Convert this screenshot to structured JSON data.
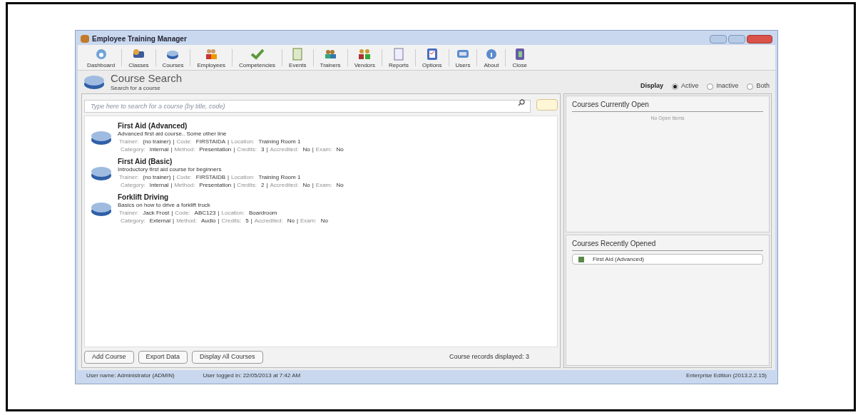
{
  "window": {
    "title": "Employee Training Manager"
  },
  "toolbar": [
    {
      "label": "Dashboard"
    },
    {
      "label": "Classes"
    },
    {
      "label": "Courses"
    },
    {
      "label": "Employees"
    },
    {
      "label": "Competencies"
    },
    {
      "label": "Events"
    },
    {
      "label": "Trainers"
    },
    {
      "label": "Vendors"
    },
    {
      "label": "Reports"
    },
    {
      "label": "Options"
    },
    {
      "label": "Users"
    },
    {
      "label": "About"
    },
    {
      "label": "Close"
    }
  ],
  "header": {
    "title": "Course Search",
    "subtitle": "Search for a course"
  },
  "display": {
    "label": "Display",
    "options": [
      {
        "label": "Active",
        "selected": true
      },
      {
        "label": "Inactive",
        "selected": false
      },
      {
        "label": "Both",
        "selected": false
      }
    ]
  },
  "search": {
    "placeholder": "Type here to search for a course (by title, code)"
  },
  "courses": [
    {
      "title": "First Aid (Advanced)",
      "description": "Advanced first aid course.. Some other line",
      "lines": [
        [
          {
            "label": "Trainer:",
            "value": "(no trainer)"
          },
          {
            "label": "Code:",
            "value": "FIRSTAIDA"
          },
          {
            "label": "Location:",
            "value": "Training Room 1"
          }
        ],
        [
          {
            "label": "Category:",
            "value": "Internal"
          },
          {
            "label": "Method:",
            "value": "Presentation"
          },
          {
            "label": "Credits:",
            "value": "3"
          },
          {
            "label": "Accredited:",
            "value": "No"
          },
          {
            "label": "Exam:",
            "value": "No"
          }
        ]
      ]
    },
    {
      "title": "First Aid (Basic)",
      "description": "Introductory first aid course for beginners",
      "lines": [
        [
          {
            "label": "Trainer:",
            "value": "(no trainer)"
          },
          {
            "label": "Code:",
            "value": "FIRSTAIDB"
          },
          {
            "label": "Location:",
            "value": "Training Room 1"
          }
        ],
        [
          {
            "label": "Category:",
            "value": "Internal"
          },
          {
            "label": "Method:",
            "value": "Presentation"
          },
          {
            "label": "Credits:",
            "value": "2"
          },
          {
            "label": "Accredited:",
            "value": "No"
          },
          {
            "label": "Exam:",
            "value": "No"
          }
        ]
      ]
    },
    {
      "title": "Forklift Driving",
      "description": "Basics on how to drive a forklift truck",
      "lines": [
        [
          {
            "label": "Trainer:",
            "value": "Jack Frost"
          },
          {
            "label": "Code:",
            "value": "ABC123"
          },
          {
            "label": "Location:",
            "value": "Boardroom"
          }
        ],
        [
          {
            "label": "Category:",
            "value": "External"
          },
          {
            "label": "Method:",
            "value": "Audio"
          },
          {
            "label": "Credits:",
            "value": "5"
          },
          {
            "label": "Accredited:",
            "value": "No"
          },
          {
            "label": "Exam:",
            "value": "No"
          }
        ]
      ]
    }
  ],
  "field_separator": "|",
  "buttons": [
    "Add Course",
    "Export Data",
    "Display All Courses"
  ],
  "record_count": "Course records displayed: 3",
  "open_panel": {
    "title": "Courses Currently Open",
    "empty_text": "No Open Items"
  },
  "recent_panel": {
    "title": "Courses Recently Opened",
    "items": [
      "First Aid (Advanced)"
    ]
  },
  "status_bar": {
    "user": "User name: Administrator (ADMIN)",
    "logged_in": "User logged in: 22/05/2013 at 7:42 AM",
    "edition": "Enterprise Edition (2013.2.2.15)"
  }
}
